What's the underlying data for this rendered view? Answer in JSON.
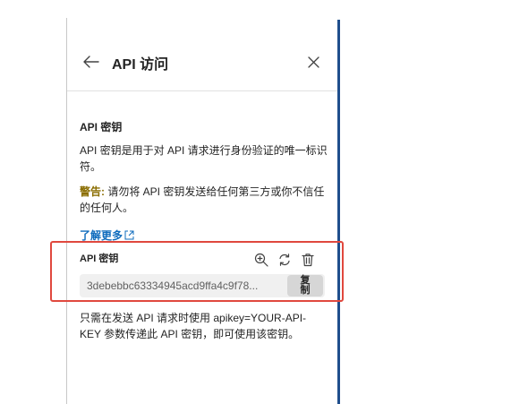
{
  "header": {
    "title": "API 访问"
  },
  "section": {
    "title": "API 密钥",
    "description": "API 密钥是用于对 API 请求进行身份验证的唯一标识符。",
    "warning_label": "警告:",
    "warning_text": " 请勿将 API 密钥发送给任何第三方或你不信任的任何人。",
    "learn_more": "了解更多"
  },
  "api_key": {
    "label": "API 密钥",
    "value": "3debebbc63334945acd9ffa4c9f78...",
    "copy_label": "复制"
  },
  "usage_note": "只需在发送 API 请求时使用 apikey=YOUR-API-KEY 参数传递此 API 密钥，即可使用该密钥。",
  "icons": {
    "back": "arrow-left-icon",
    "close": "close-icon",
    "external": "external-link-icon",
    "zoom": "zoom-in-icon",
    "regenerate": "refresh-icon",
    "delete": "trash-icon"
  },
  "colors": {
    "link": "#0f6cbd",
    "warning": "#8a6d00",
    "highlight": "#e0483e",
    "accent_bar": "#1f4e8c"
  }
}
